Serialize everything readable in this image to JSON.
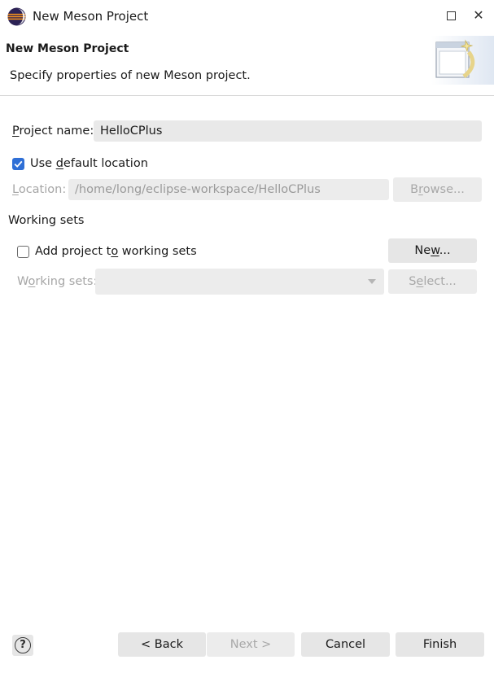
{
  "window": {
    "title": "New Meson Project",
    "maximize_glyph": "□",
    "close_glyph": "✕"
  },
  "header": {
    "title": "New Meson Project",
    "description": "Specify properties of new Meson project."
  },
  "project_name": {
    "label": "Project name:",
    "value": "HelloCPlus"
  },
  "default_location": {
    "label": "Use default location",
    "checked": true
  },
  "location": {
    "label": "Location:",
    "value": "/home/long/eclipse-workspace/HelloCPlus",
    "browse_label": "Browse..."
  },
  "working_sets": {
    "group_label": "Working sets",
    "add_label": "Add project to working sets",
    "add_checked": false,
    "new_label": "New...",
    "sets_label": "Working sets:",
    "sets_value": "",
    "select_label": "Select..."
  },
  "footer": {
    "help_glyph": "?",
    "back_label": "< Back",
    "next_label": "Next >",
    "cancel_label": "Cancel",
    "finish_label": "Finish"
  },
  "colors": {
    "accent": "#2f6fd6",
    "button_bg": "#e6e6e6",
    "field_bg": "#e9e9e9",
    "disabled_text": "#a6a6a6"
  }
}
